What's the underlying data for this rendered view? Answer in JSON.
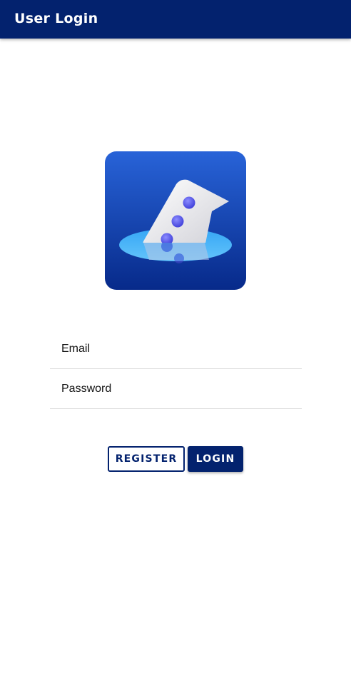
{
  "app_bar": {
    "title": "User Login"
  },
  "logo": {
    "icon": "app-logo-icon"
  },
  "form": {
    "email_placeholder": "Email",
    "email_value": "",
    "password_placeholder": "Password",
    "password_value": ""
  },
  "actions": {
    "register_label": "REGISTER",
    "login_label": "LOGIN"
  },
  "colors": {
    "primary": "#03226e",
    "background": "#ffffff",
    "divider": "#dcdcdc"
  }
}
